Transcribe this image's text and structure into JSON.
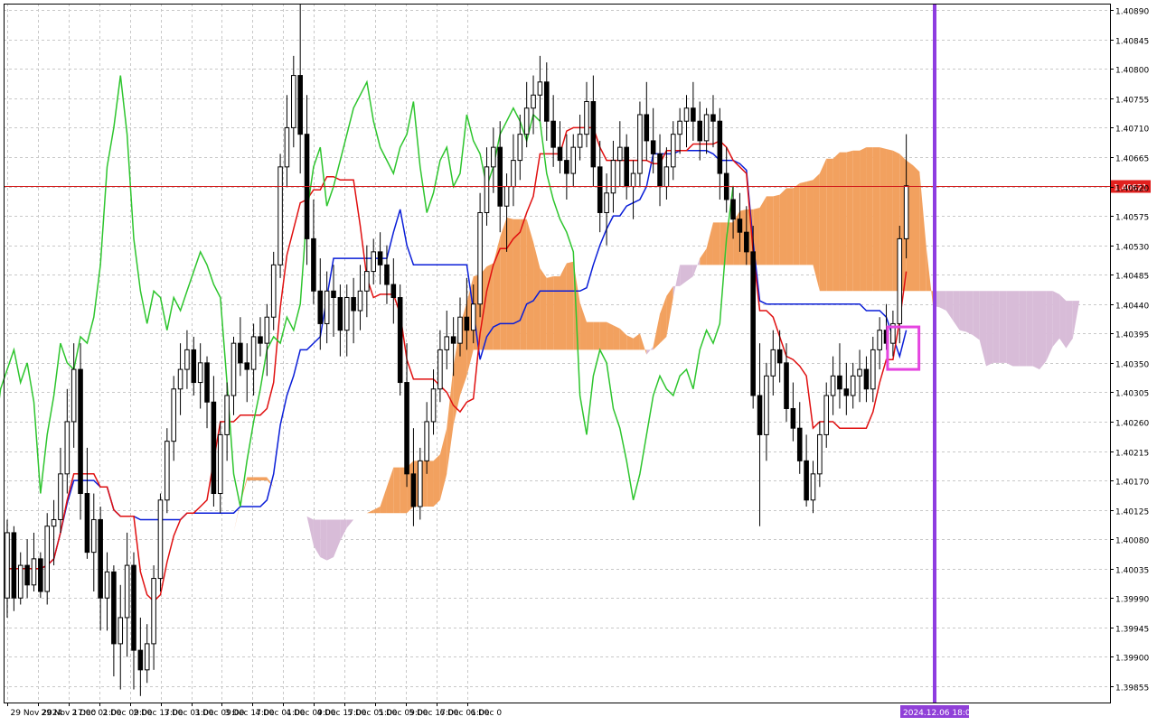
{
  "chart_data": {
    "type": "candlestick",
    "symbol_hint": "",
    "price_scale": {
      "min": 1.3983,
      "max": 1.409,
      "ticks": [
        1.4089,
        1.40845,
        1.408,
        1.40755,
        1.4071,
        1.40665,
        1.4062,
        1.40575,
        1.4053,
        1.40485,
        1.4044,
        1.40395,
        1.4035,
        1.40305,
        1.4026,
        1.40215,
        1.4017,
        1.40125,
        1.4008,
        1.40035,
        1.3999,
        1.39945,
        1.399,
        1.39855
      ],
      "tick_labels": [
        "1.40890",
        "1.40845",
        "1.40800",
        "1.40755",
        "1.40710",
        "1.40665",
        "1.40620",
        "1.40575",
        "1.40530",
        "1.40485",
        "1.40440",
        "1.40395",
        "1.40350",
        "1.40305",
        "1.40260",
        "1.40215",
        "1.40170",
        "1.40125",
        "1.40080",
        "1.40035",
        "1.39990",
        "1.39945",
        "1.39900",
        "1.39855"
      ]
    },
    "current_price": 1.40621,
    "current_price_label": "1.40621",
    "time_axis": {
      "labels": [
        "29 Nov 2024",
        "29 Nov 17:00",
        "2 Dec 01:00",
        "2 Dec 09:00",
        "2 Dec 17:00",
        "3 Dec 01:00",
        "3 Dec 09:00",
        "3 Dec 17:00",
        "4 Dec 01:00",
        "4 Dec 09:00",
        "4 Dec 17:00",
        "5 Dec 01:00",
        "5 Dec 09:00",
        "5 Dec 17:00",
        "6 Dec 01:00",
        "6 Dec 0"
      ],
      "label_bar_index": [
        0,
        16,
        32,
        48,
        64,
        80,
        96,
        112,
        128,
        144,
        160,
        176,
        192,
        208,
        224,
        240
      ],
      "cursor_label": "2024.12.06 18:00",
      "cursor_bar_index": 257
    },
    "candles_ohlc": [
      [
        1.3999,
        1.4011,
        1.3996,
        1.4009
      ],
      [
        1.4009,
        1.401,
        1.3997,
        1.3999
      ],
      [
        1.3999,
        1.4006,
        1.3998,
        1.4004
      ],
      [
        1.4004,
        1.4008,
        1.3999,
        1.4001
      ],
      [
        1.4001,
        1.4009,
        1.4,
        1.4005
      ],
      [
        1.4005,
        1.4006,
        1.3999,
        1.4
      ],
      [
        1.4,
        1.4012,
        1.3998,
        1.401
      ],
      [
        1.401,
        1.4014,
        1.4004,
        1.4011
      ],
      [
        1.4011,
        1.4022,
        1.4009,
        1.4018
      ],
      [
        1.4018,
        1.4031,
        1.4015,
        1.4026
      ],
      [
        1.4026,
        1.4038,
        1.4022,
        1.4034
      ],
      [
        1.4034,
        1.4038,
        1.4011,
        1.4015
      ],
      [
        1.4015,
        1.4022,
        1.4005,
        1.4006
      ],
      [
        1.4006,
        1.4015,
        1.4,
        1.4011
      ],
      [
        1.4011,
        1.4013,
        1.3994,
        1.3999
      ],
      [
        1.3999,
        1.4006,
        1.3994,
        1.4003
      ],
      [
        1.4003,
        1.4004,
        1.3987,
        1.3992
      ],
      [
        1.3992,
        1.4001,
        1.3985,
        1.3996
      ],
      [
        1.3996,
        1.4009,
        1.399,
        1.4004
      ],
      [
        1.4004,
        1.4006,
        1.3985,
        1.3991
      ],
      [
        1.3991,
        1.3996,
        1.3984,
        1.3988
      ],
      [
        1.3988,
        1.3995,
        1.3986,
        1.3992
      ],
      [
        1.3992,
        1.4004,
        1.3988,
        1.4002
      ],
      [
        1.4002,
        1.4015,
        1.4,
        1.4014
      ],
      [
        1.4014,
        1.4025,
        1.4012,
        1.4023
      ],
      [
        1.4023,
        1.4033,
        1.402,
        1.4031
      ],
      [
        1.4031,
        1.4038,
        1.4027,
        1.4034
      ],
      [
        1.4034,
        1.404,
        1.4031,
        1.4037
      ],
      [
        1.4037,
        1.4039,
        1.403,
        1.4032
      ],
      [
        1.4032,
        1.4038,
        1.4028,
        1.4035
      ],
      [
        1.4035,
        1.4036,
        1.4025,
        1.4029
      ],
      [
        1.4029,
        1.4033,
        1.4013,
        1.4015
      ],
      [
        1.4015,
        1.4026,
        1.4012,
        1.4024
      ],
      [
        1.4024,
        1.4032,
        1.402,
        1.403
      ],
      [
        1.403,
        1.4039,
        1.4027,
        1.4038
      ],
      [
        1.4038,
        1.4042,
        1.4033,
        1.4035
      ],
      [
        1.4035,
        1.4038,
        1.4029,
        1.4034
      ],
      [
        1.4034,
        1.4041,
        1.403,
        1.4039
      ],
      [
        1.4039,
        1.4042,
        1.4036,
        1.4038
      ],
      [
        1.4038,
        1.4044,
        1.4033,
        1.4042
      ],
      [
        1.4042,
        1.4052,
        1.404,
        1.405
      ],
      [
        1.405,
        1.4067,
        1.4048,
        1.4065
      ],
      [
        1.4065,
        1.4076,
        1.4062,
        1.4071
      ],
      [
        1.4071,
        1.4082,
        1.4068,
        1.4079
      ],
      [
        1.4079,
        1.409,
        1.4064,
        1.407
      ],
      [
        1.407,
        1.4076,
        1.405,
        1.4054
      ],
      [
        1.4054,
        1.406,
        1.4044,
        1.4046
      ],
      [
        1.4046,
        1.4051,
        1.4037,
        1.4041
      ],
      [
        1.4041,
        1.4049,
        1.4038,
        1.4046
      ],
      [
        1.4046,
        1.405,
        1.4039,
        1.4045
      ],
      [
        1.4045,
        1.4047,
        1.4036,
        1.404
      ],
      [
        1.404,
        1.4047,
        1.4036,
        1.4045
      ],
      [
        1.4045,
        1.4048,
        1.4038,
        1.4043
      ],
      [
        1.4043,
        1.405,
        1.404,
        1.4046
      ],
      [
        1.4046,
        1.4053,
        1.4042,
        1.4049
      ],
      [
        1.4049,
        1.4054,
        1.4047,
        1.4052
      ],
      [
        1.4052,
        1.4055,
        1.4047,
        1.405
      ],
      [
        1.405,
        1.4053,
        1.4044,
        1.4047
      ],
      [
        1.4047,
        1.4051,
        1.4041,
        1.4045
      ],
      [
        1.4045,
        1.4047,
        1.403,
        1.4032
      ],
      [
        1.4032,
        1.4038,
        1.4016,
        1.4018
      ],
      [
        1.4018,
        1.4025,
        1.401,
        1.4013
      ],
      [
        1.4013,
        1.4022,
        1.4011,
        1.402
      ],
      [
        1.402,
        1.4029,
        1.4018,
        1.4026
      ],
      [
        1.4026,
        1.4034,
        1.4024,
        1.4031
      ],
      [
        1.4031,
        1.404,
        1.4029,
        1.4037
      ],
      [
        1.4037,
        1.4043,
        1.4034,
        1.4039
      ],
      [
        1.4039,
        1.4042,
        1.4033,
        1.4038
      ],
      [
        1.4038,
        1.4045,
        1.4036,
        1.4042
      ],
      [
        1.4042,
        1.4048,
        1.4037,
        1.404
      ],
      [
        1.404,
        1.4047,
        1.4038,
        1.4044
      ],
      [
        1.4044,
        1.4061,
        1.4042,
        1.4058
      ],
      [
        1.4058,
        1.4068,
        1.4056,
        1.4065
      ],
      [
        1.4065,
        1.4071,
        1.4061,
        1.4068
      ],
      [
        1.4068,
        1.4072,
        1.4055,
        1.4059
      ],
      [
        1.4059,
        1.4064,
        1.4052,
        1.4062
      ],
      [
        1.4062,
        1.407,
        1.4059,
        1.4066
      ],
      [
        1.4066,
        1.4073,
        1.4063,
        1.407
      ],
      [
        1.407,
        1.4078,
        1.4068,
        1.4074
      ],
      [
        1.4074,
        1.4079,
        1.407,
        1.4076
      ],
      [
        1.4076,
        1.4082,
        1.4072,
        1.4078
      ],
      [
        1.4078,
        1.4081,
        1.4069,
        1.4072
      ],
      [
        1.4072,
        1.4076,
        1.4065,
        1.4068
      ],
      [
        1.4068,
        1.4072,
        1.4064,
        1.4066
      ],
      [
        1.4066,
        1.407,
        1.406,
        1.4064
      ],
      [
        1.4064,
        1.407,
        1.4062,
        1.4068
      ],
      [
        1.4068,
        1.4073,
        1.4066,
        1.407
      ],
      [
        1.407,
        1.4078,
        1.4068,
        1.4075
      ],
      [
        1.4075,
        1.4079,
        1.4062,
        1.4065
      ],
      [
        1.4065,
        1.4069,
        1.4055,
        1.4058
      ],
      [
        1.4058,
        1.4064,
        1.4053,
        1.4061
      ],
      [
        1.4061,
        1.4069,
        1.4058,
        1.4066
      ],
      [
        1.4066,
        1.4072,
        1.4062,
        1.4068
      ],
      [
        1.4068,
        1.407,
        1.406,
        1.4062
      ],
      [
        1.4062,
        1.4066,
        1.4057,
        1.4064
      ],
      [
        1.4064,
        1.4075,
        1.4062,
        1.4073
      ],
      [
        1.4073,
        1.4078,
        1.4066,
        1.4069
      ],
      [
        1.4069,
        1.4074,
        1.4064,
        1.4067
      ],
      [
        1.4067,
        1.407,
        1.4059,
        1.4062
      ],
      [
        1.4062,
        1.4068,
        1.406,
        1.4065
      ],
      [
        1.4065,
        1.4072,
        1.4063,
        1.407
      ],
      [
        1.407,
        1.4074,
        1.4067,
        1.4072
      ],
      [
        1.4072,
        1.4076,
        1.4068,
        1.4074
      ],
      [
        1.4074,
        1.4078,
        1.4069,
        1.4072
      ],
      [
        1.4072,
        1.4075,
        1.4066,
        1.4069
      ],
      [
        1.4069,
        1.4074,
        1.4067,
        1.4073
      ],
      [
        1.4073,
        1.4076,
        1.4068,
        1.4072
      ],
      [
        1.4072,
        1.4074,
        1.406,
        1.4064
      ],
      [
        1.4064,
        1.4068,
        1.4058,
        1.406
      ],
      [
        1.406,
        1.4062,
        1.4054,
        1.4057
      ],
      [
        1.4057,
        1.4061,
        1.4052,
        1.4055
      ],
      [
        1.4055,
        1.4059,
        1.405,
        1.4052
      ],
      [
        1.4052,
        1.4056,
        1.4028,
        1.403
      ],
      [
        1.403,
        1.4038,
        1.401,
        1.4024
      ],
      [
        1.4024,
        1.4035,
        1.402,
        1.4033
      ],
      [
        1.4033,
        1.404,
        1.403,
        1.4037
      ],
      [
        1.4037,
        1.404,
        1.4032,
        1.4035
      ],
      [
        1.4035,
        1.4038,
        1.4026,
        1.4028
      ],
      [
        1.4028,
        1.4032,
        1.4023,
        1.4025
      ],
      [
        1.4025,
        1.4029,
        1.4018,
        1.402
      ],
      [
        1.402,
        1.4024,
        1.4013,
        1.4014
      ],
      [
        1.4014,
        1.402,
        1.4012,
        1.4018
      ],
      [
        1.4018,
        1.4026,
        1.4016,
        1.4024
      ],
      [
        1.4024,
        1.4032,
        1.4022,
        1.403
      ],
      [
        1.403,
        1.4036,
        1.4027,
        1.4033
      ],
      [
        1.4033,
        1.4038,
        1.4028,
        1.4031
      ],
      [
        1.4031,
        1.4035,
        1.4027,
        1.403
      ],
      [
        1.403,
        1.4035,
        1.4028,
        1.4033
      ],
      [
        1.4033,
        1.4037,
        1.4029,
        1.4034
      ],
      [
        1.4034,
        1.4036,
        1.4029,
        1.4031
      ],
      [
        1.4031,
        1.4039,
        1.4029,
        1.4037
      ],
      [
        1.4037,
        1.4042,
        1.4034,
        1.404
      ],
      [
        1.404,
        1.4044,
        1.4037,
        1.4038
      ],
      [
        1.4038,
        1.4043,
        1.4036,
        1.4041
      ],
      [
        1.4041,
        1.4056,
        1.4038,
        1.4054
      ],
      [
        1.4054,
        1.407,
        1.4051,
        1.40621
      ]
    ],
    "lines": {
      "tenkan_color": "#e01010",
      "kijun_color": "#0a1ed8",
      "chikou_color": "#2ec52e",
      "cloud_bull_color": "#f2a15f",
      "cloud_bear_color": "#d8bcd8"
    },
    "colors": {
      "background": "#ffffff",
      "grid": "#c8c8c8",
      "bull_candle_body": "#ffffff",
      "bear_candle_body": "#000000",
      "candle_outline": "#000000",
      "price_line": "#d21a1a",
      "price_label_bg": "#e0201e",
      "cursor_line": "#8e3de0",
      "cursor_label_bg": "#9040d8",
      "highlight_box": "#e544e0"
    }
  }
}
